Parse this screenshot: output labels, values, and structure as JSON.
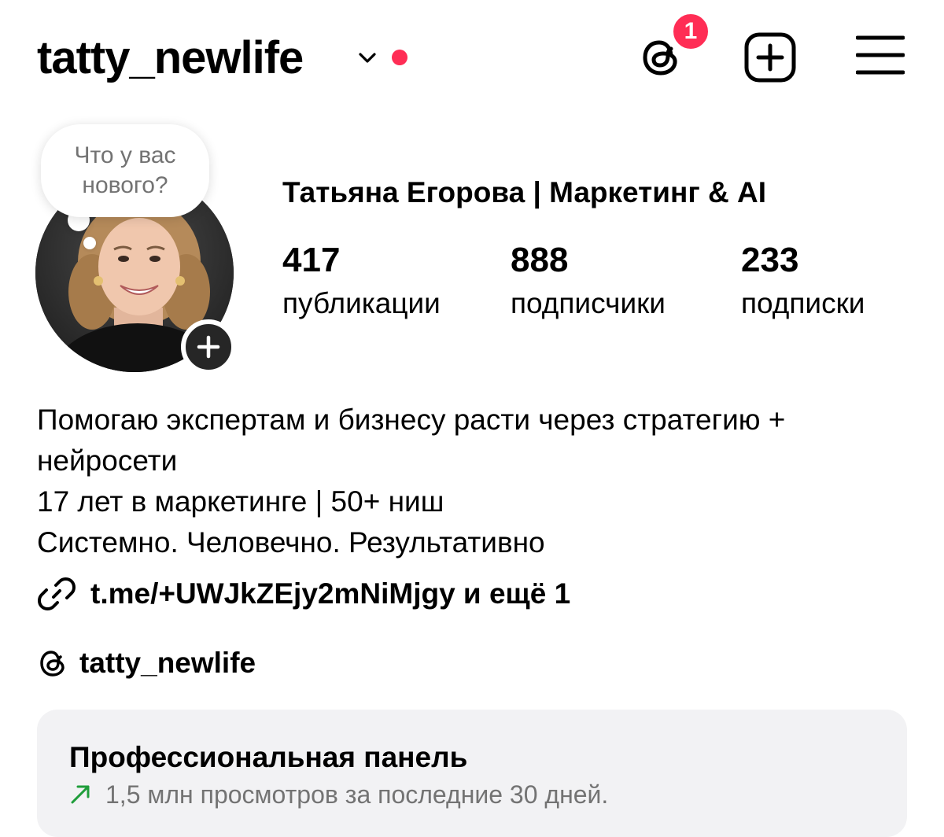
{
  "header": {
    "username": "tatty_newlife",
    "notification_count": "1",
    "icons": [
      "chevron-down-icon",
      "threads-icon",
      "add-post-icon",
      "hamburger-menu-icon"
    ],
    "accent_color": "#ff2d55"
  },
  "note_bubble": {
    "text": "Что у вас нового?"
  },
  "profile": {
    "full_name": "Татьяна Егорова | Маркетинг & AI",
    "stats": [
      {
        "value": "417",
        "label": "публикации"
      },
      {
        "value": "888",
        "label": "подписчики"
      },
      {
        "value": "233",
        "label": "подписки"
      }
    ]
  },
  "bio": {
    "lines": [
      "Помогаю экспертам и бизнесу расти через стратегию +",
      "нейросети",
      "17 лет в маркетинге | 50+ ниш",
      "Системно. Человечно. Результативно"
    ],
    "link": "t.me/+UWJkZEjy2mNiMjgy и ещё 1",
    "threads_handle": "tatty_newlife"
  },
  "pro_panel": {
    "title": "Профессиональная панель",
    "subtitle": "1,5 млн просмотров за последние 30 дней.",
    "trend_color": "#1f9d3a"
  }
}
